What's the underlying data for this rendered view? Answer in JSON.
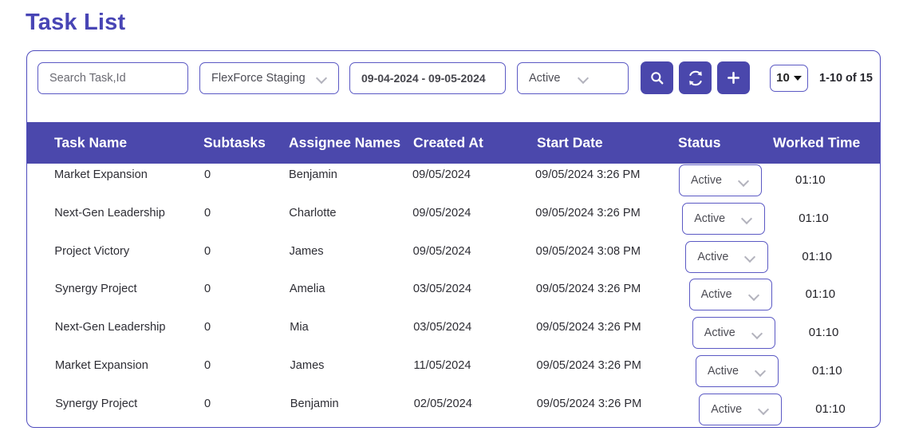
{
  "page_title": "Task List",
  "toolbar": {
    "search_placeholder": "Search Task,Id",
    "project_value": "FlexForce Staging",
    "date_range_value": "09-04-2024 - 09-05-2024",
    "status_filter_value": "Active",
    "search_button_icon": "search-icon",
    "refresh_button_icon": "refresh-icon",
    "add_button_icon": "plus-icon",
    "page_size_value": "10",
    "pagination_range": "1-10 of 15"
  },
  "table": {
    "columns": [
      "Task Name",
      "Subtasks",
      "Assignee Names",
      "Created At",
      "Start Date",
      "Status",
      "Worked Time"
    ],
    "rows": [
      {
        "task_name": "Market Expansion",
        "subtasks": "0",
        "assignee": "Benjamin",
        "created_at": "09/05/2024",
        "start_date": "09/05/2024 3:26 PM",
        "status": "Active",
        "worked_time": "01:10"
      },
      {
        "task_name": "Next-Gen Leadership",
        "subtasks": "0",
        "assignee": "Charlotte",
        "created_at": "09/05/2024",
        "start_date": "09/05/2024 3:26 PM",
        "status": "Active",
        "worked_time": "01:10"
      },
      {
        "task_name": "Project Victory",
        "subtasks": "0",
        "assignee": "James",
        "created_at": "09/05/2024",
        "start_date": "09/05/2024 3:08 PM",
        "status": "Active",
        "worked_time": "01:10"
      },
      {
        "task_name": "Synergy Project",
        "subtasks": "0",
        "assignee": "Amelia",
        "created_at": "03/05/2024",
        "start_date": "09/05/2024 3:26 PM",
        "status": "Active",
        "worked_time": "01:10"
      },
      {
        "task_name": "Next-Gen Leadership",
        "subtasks": "0",
        "assignee": "Mia",
        "created_at": "03/05/2024",
        "start_date": "09/05/2024 3:26 PM",
        "status": "Active",
        "worked_time": "01:10"
      },
      {
        "task_name": "Market Expansion",
        "subtasks": "0",
        "assignee": "James",
        "created_at": "11/05/2024",
        "start_date": "09/05/2024 3:26 PM",
        "status": "Active",
        "worked_time": "01:10"
      },
      {
        "task_name": "Synergy Project",
        "subtasks": "0",
        "assignee": "Benjamin",
        "created_at": "02/05/2024",
        "start_date": "09/05/2024 3:26 PM",
        "status": "Active",
        "worked_time": "01:10"
      }
    ]
  },
  "colors": {
    "accent": "#4b48ac",
    "title": "#4845b5",
    "border": "#5b59c4",
    "header_text": "#ffffff"
  }
}
